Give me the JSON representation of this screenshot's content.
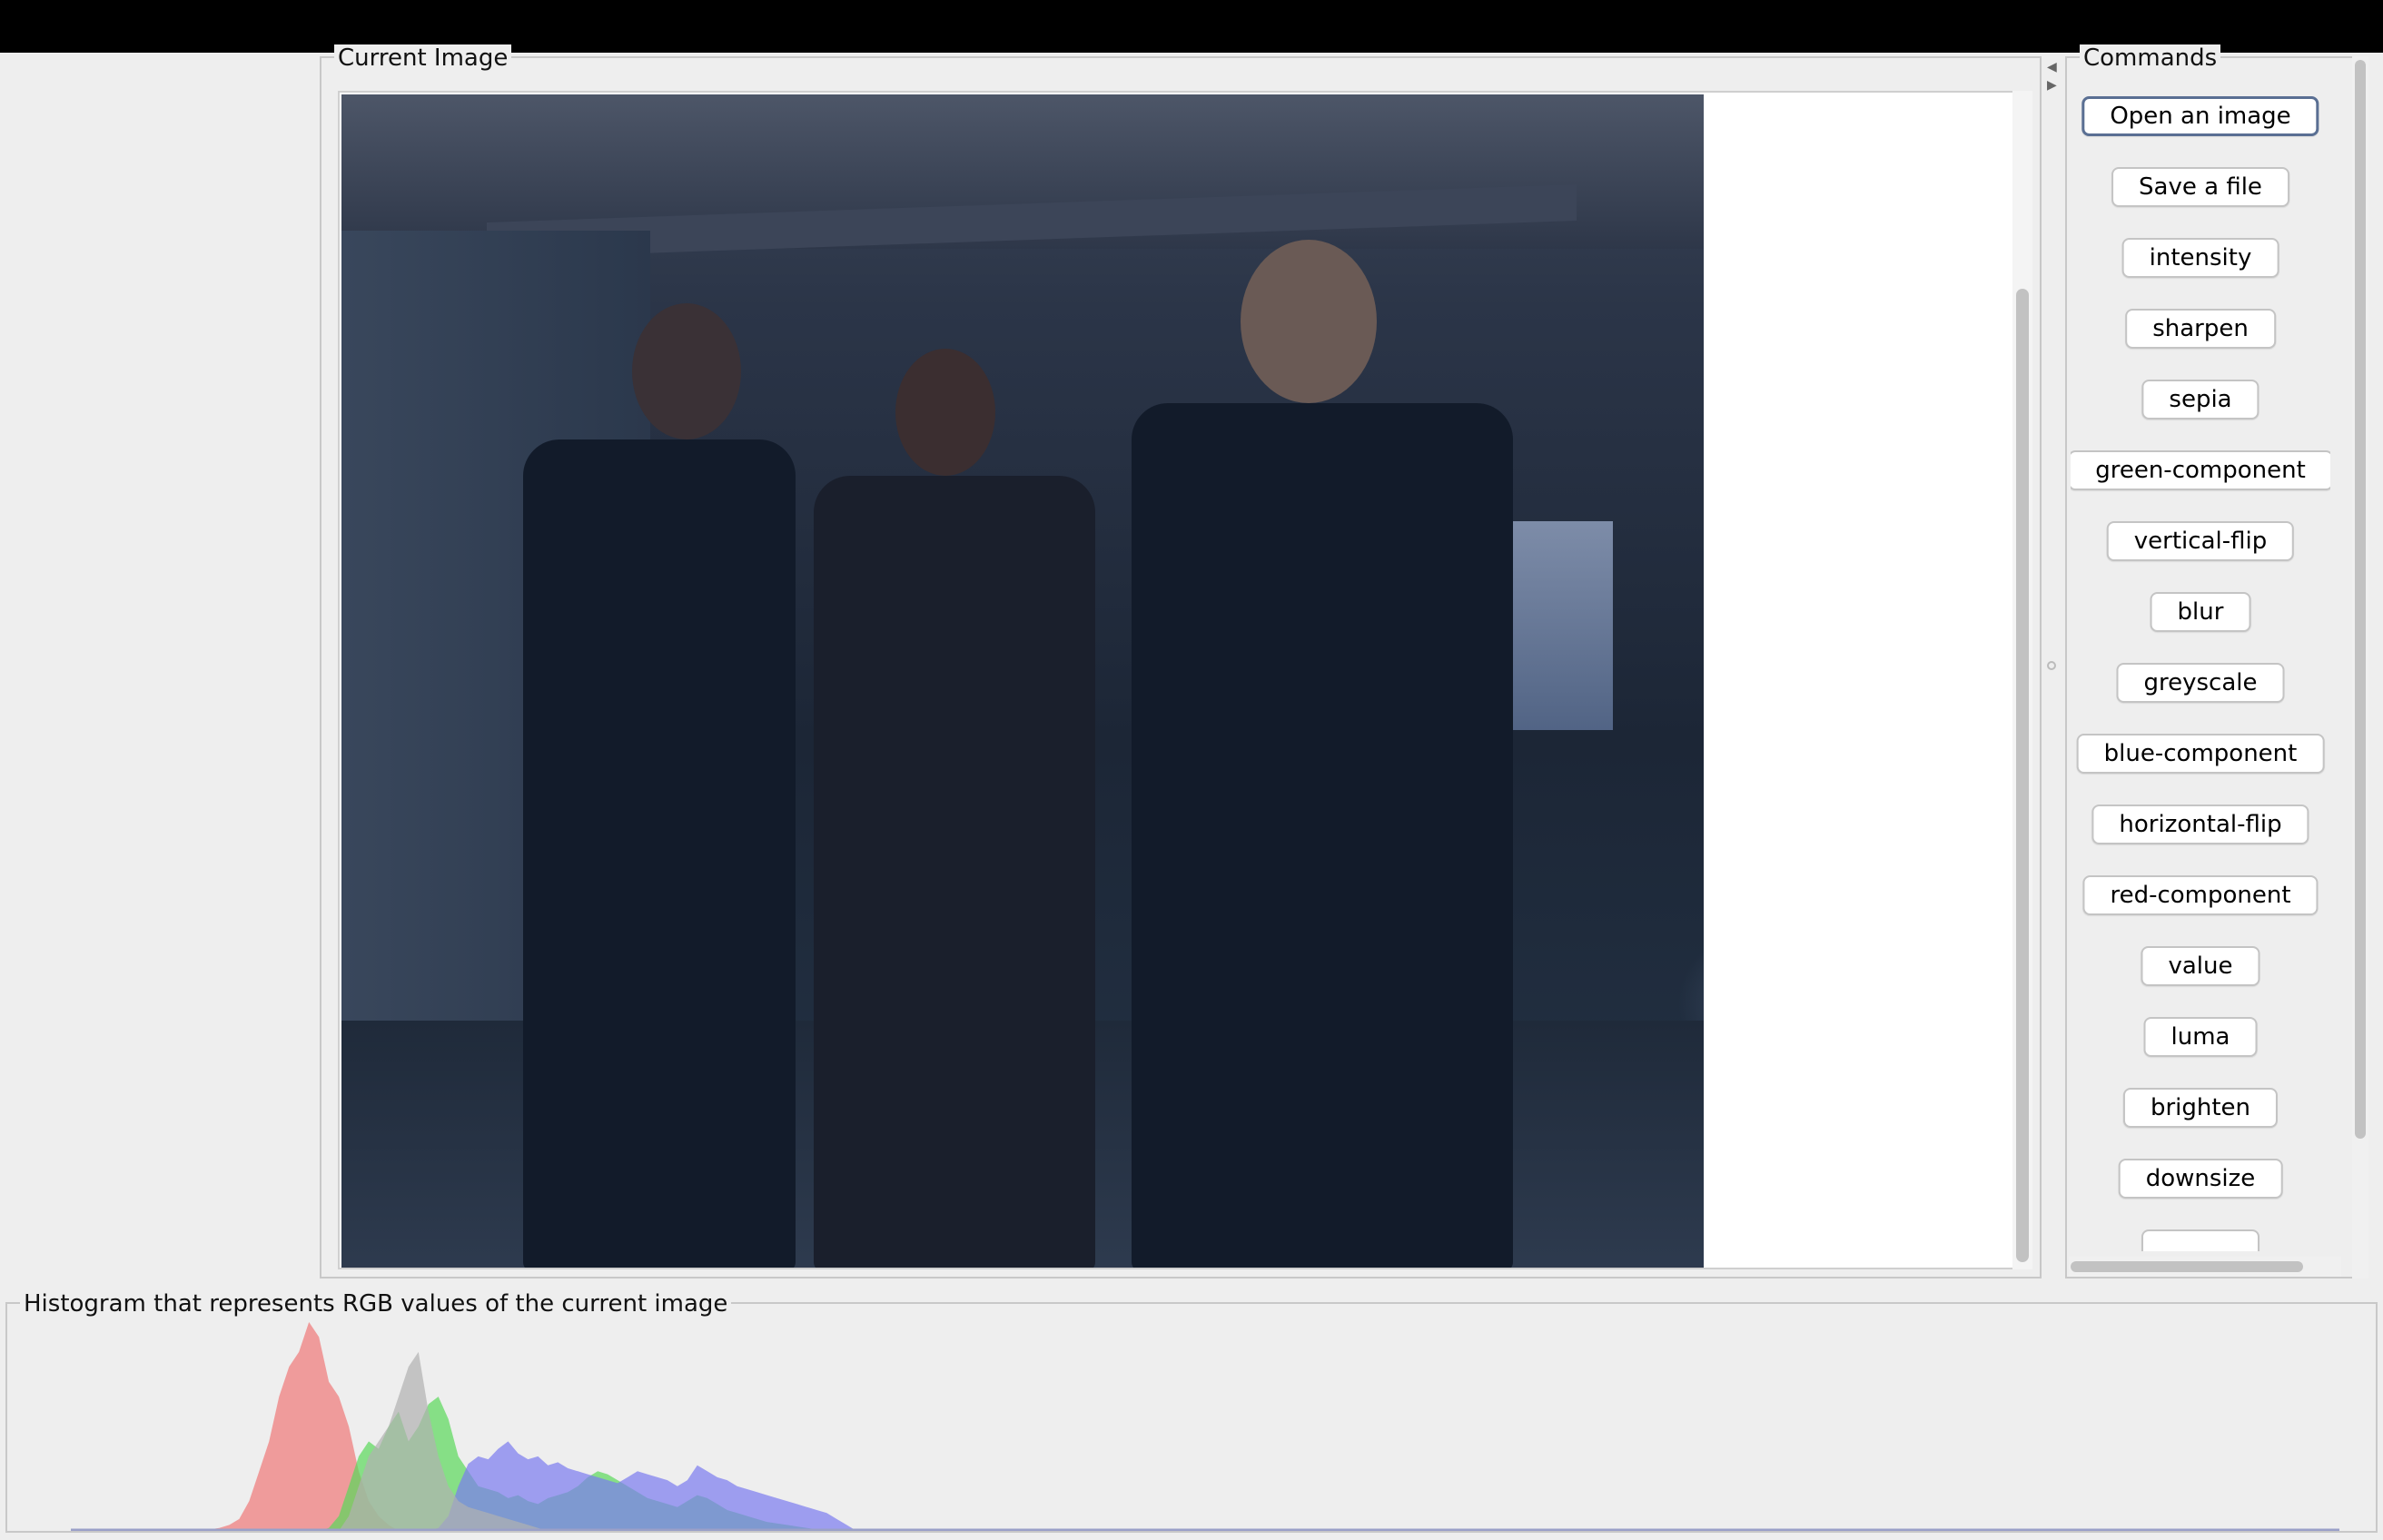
{
  "image_panel": {
    "title": "Current Image"
  },
  "commands_panel": {
    "title": "Commands",
    "buttons": [
      "Open an image",
      "Save a file",
      "intensity",
      "sharpen",
      "sepia",
      "green-component",
      "vertical-flip",
      "blur",
      "greyscale",
      "blue-component",
      "horizontal-flip",
      "red-component",
      "value",
      "luma",
      "brighten",
      "downsize"
    ],
    "focused_button": "Open an image"
  },
  "histogram_panel": {
    "title": "Histogram that represents RGB values of the current image"
  },
  "chart_data": {
    "type": "area",
    "x_range": [
      0,
      255
    ],
    "series": [
      {
        "color": "#f07878",
        "values": [
          0,
          0,
          0,
          0,
          0,
          0,
          0,
          0,
          0,
          0,
          0,
          0,
          0,
          1,
          2,
          4,
          8,
          20,
          40,
          60,
          90,
          110,
          120,
          140,
          130,
          100,
          90,
          70,
          40,
          20,
          10,
          4,
          0,
          0,
          0,
          0,
          0,
          0,
          0,
          0,
          0,
          0,
          0,
          0,
          0,
          0,
          0,
          0
        ]
      },
      {
        "color": "#5ad85a",
        "values": [
          0,
          0,
          0,
          0,
          0,
          0,
          0,
          0,
          0,
          0,
          0,
          0,
          0,
          0,
          0,
          0,
          0,
          0,
          0,
          0,
          0,
          0,
          0,
          0,
          0,
          2,
          10,
          30,
          50,
          60,
          55,
          70,
          80,
          60,
          70,
          85,
          90,
          75,
          50,
          40,
          30,
          28,
          26,
          22,
          24,
          20,
          18,
          22,
          24,
          26,
          30,
          36,
          40,
          38,
          34,
          30,
          26,
          22,
          20,
          18,
          16,
          20,
          24,
          22,
          18,
          14,
          12,
          10,
          8,
          6,
          5,
          4,
          3,
          2,
          1,
          0
        ]
      },
      {
        "color": "#7b7bf0",
        "values": [
          0,
          0,
          0,
          0,
          0,
          0,
          0,
          0,
          0,
          0,
          0,
          0,
          0,
          0,
          0,
          0,
          0,
          0,
          0,
          0,
          0,
          0,
          0,
          0,
          0,
          0,
          0,
          0,
          0,
          0,
          0,
          0,
          0,
          0,
          0,
          0,
          2,
          10,
          30,
          45,
          50,
          48,
          55,
          60,
          52,
          48,
          50,
          44,
          46,
          42,
          40,
          38,
          36,
          34,
          32,
          36,
          40,
          38,
          36,
          34,
          30,
          34,
          44,
          40,
          36,
          34,
          30,
          28,
          26,
          24,
          22,
          20,
          18,
          16,
          14,
          12,
          8,
          4,
          0
        ]
      },
      {
        "color": "#b0b0b0",
        "values": [
          0,
          0,
          0,
          0,
          0,
          0,
          0,
          0,
          0,
          0,
          0,
          0,
          0,
          0,
          0,
          0,
          0,
          0,
          0,
          0,
          0,
          0,
          0,
          0,
          0,
          0,
          0,
          10,
          30,
          50,
          60,
          70,
          90,
          110,
          120,
          80,
          50,
          30,
          20,
          16,
          14,
          12,
          10,
          8,
          6,
          4,
          2,
          0
        ]
      }
    ]
  }
}
